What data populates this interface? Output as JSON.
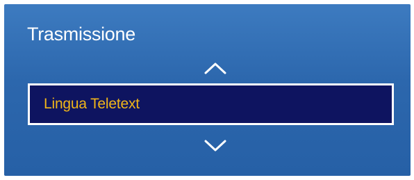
{
  "menu": {
    "title": "Trasmissione",
    "selected_item_label": "Lingua Teletext",
    "up_icon": "chevron-up-icon",
    "down_icon": "chevron-down-icon"
  },
  "colors": {
    "panel_background": "#2c67ad",
    "selected_background": "#0e1460",
    "selected_text": "#f2b619",
    "title_text": "#ffffff"
  }
}
